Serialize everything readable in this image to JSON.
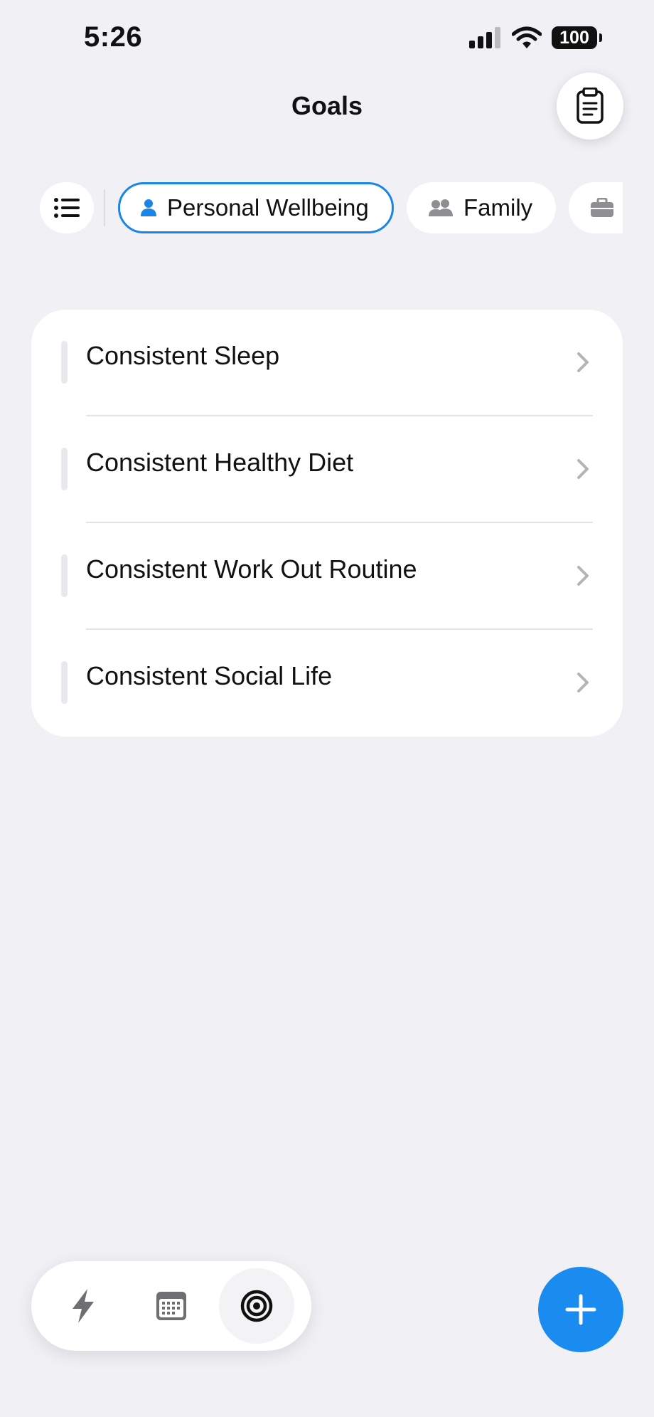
{
  "status_bar": {
    "time": "5:26",
    "battery": "100"
  },
  "header": {
    "title": "Goals"
  },
  "filters": [
    {
      "label": "Personal Wellbeing",
      "icon": "person-icon",
      "selected": true
    },
    {
      "label": "Family",
      "icon": "people-icon",
      "selected": false
    },
    {
      "label": "",
      "icon": "briefcase-icon",
      "selected": false
    }
  ],
  "goals": [
    {
      "title": "Consistent Sleep"
    },
    {
      "title": "Consistent Healthy Diet"
    },
    {
      "title": "Consistent Work Out Routine"
    },
    {
      "title": "Consistent Social Life"
    }
  ],
  "bottom_nav": [
    {
      "icon": "bolt-icon",
      "active": false
    },
    {
      "icon": "calendar-icon",
      "active": false
    },
    {
      "icon": "target-icon",
      "active": true
    }
  ],
  "colors": {
    "accent": "#1a85e6",
    "fab": "#1a8cf0",
    "background": "#f0f0f5"
  }
}
